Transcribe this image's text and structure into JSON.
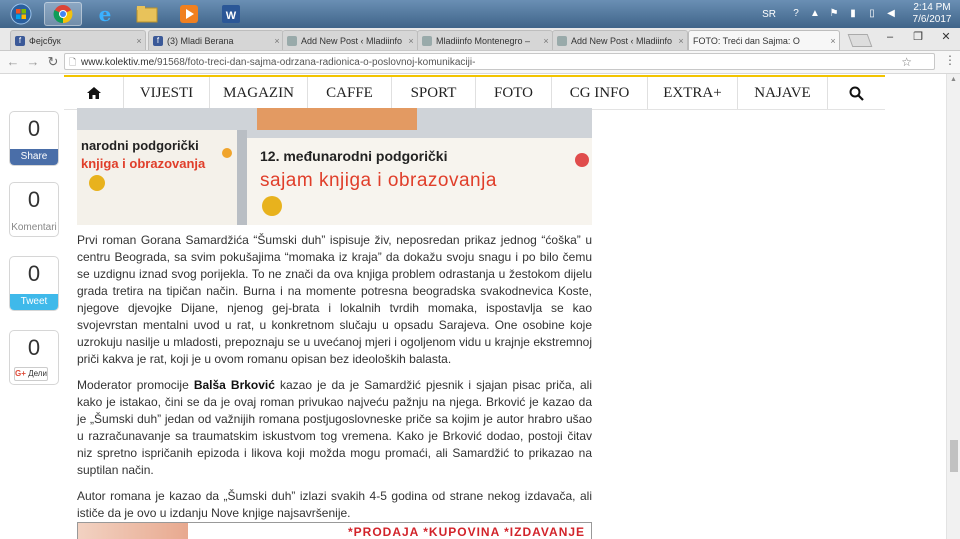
{
  "taskbar": {
    "language": "SR",
    "time": "2:14 PM",
    "date": "7/6/2017",
    "apps": [
      "start-orb-icon",
      "chrome-icon",
      "ie-icon",
      "file-explorer-icon",
      "media-player-icon",
      "word-icon"
    ]
  },
  "tabs": [
    {
      "title": "Фејсбук",
      "favicon": "f",
      "color": "#3b5998",
      "active": false
    },
    {
      "title": "(3) Mladi Berana",
      "favicon": "f",
      "color": "#3b5998",
      "active": false
    },
    {
      "title": "Add New Post ‹ Mladiinfo",
      "favicon": "",
      "color": "#9aa",
      "active": false
    },
    {
      "title": "Mladiinfo Montenegro –",
      "favicon": "",
      "color": "#9aa",
      "active": false
    },
    {
      "title": "Add New Post ‹ Mladiinfo",
      "favicon": "",
      "color": "#9aa",
      "active": false
    },
    {
      "title": "FOTO: Treći dan Sajma: O",
      "favicon": "",
      "color": "#9aa",
      "active": true
    }
  ],
  "omnibox": {
    "host": "www.kolektiv.me",
    "path": "/91568/foto-treci-dan-sajma-odrzana-radionica-o-poslovnoj-komunikaciji-"
  },
  "nav": {
    "items": [
      "VIJESTI",
      "MAGAZIN",
      "CAFFE",
      "SPORT",
      "FOTO",
      "CG INFO",
      "EXTRA+",
      "NAJAVE"
    ]
  },
  "share": [
    {
      "count": "0",
      "label": "Share",
      "color": "#4a6ea8"
    },
    {
      "count": "0",
      "label": "Komentari",
      "color": ""
    },
    {
      "count": "0",
      "label": "Tweet",
      "color": "#3fb9ea"
    },
    {
      "count": "0",
      "label": "Дели",
      "color": ""
    }
  ],
  "hero": {
    "banner_left_line1": "narodni podgorički",
    "banner_left_line2": "knjiga i obrazovanja",
    "banner_right_line1": "12. međunarodni podgorički",
    "banner_right_line2": "sajam knjiga i obrazovanja"
  },
  "article": {
    "p1": "Prvi roman Gorana Samardžića “Šumski duh” ispisuje živ, neposredan prikaz jednog “ćoška” u centru Beograda, sa svim pokušajima “momaka iz kraja” da dokažu svoju snagu i po bilo čemu se uzdignu iznad svog porijekla. To ne znači da ova knjiga problem odrastanja u žestokom dijelu grada tretira na tipičan način. Burna i na momente potresna beogradska svakodnevica Koste, njegove djevojke Dijane, njenog gej-brata i lokalnih tvrdih momaka, ispostavlja se kao svojevrstan mentalni uvod u rat, u konkretnom slučaju u opsadu Sarajeva. One osobine koje uzrokuju nasilje u mladosti, prepoznaju se u uvećanoj mjeri i ogoljenom vidu u krajnje ekstremnoj priči kakva je rat, koji je u ovom romanu opisan bez ideoloških balasta.",
    "p2_prefix": "Moderator promocije ",
    "p2_name": "Balša Brković",
    "p2_rest": " kazao je da je Samardžić pjesnik i sjajan pisac priča, ali kako je istakao, čini se da je ovaj roman privukao najveću pažnju na njega. Brković je kazao da je „Šumski duh” jedan od važnijih romana postjugoslovneske priče sa kojim je autor hrabro ušao u razračunavanje sa traumatskim iskustvom tog vremena. Kako je Brković dodao, postoji čitav niz spretno ispričanih epizoda i likova koji možda mogu promaći, ali Samardžić to prikazao na suptilan način.",
    "p3": "Autor romana je kazao da „Šumski duh” izlazi svakih 4-5 godina od strane nekog izdavača, ali ističe da je ovo u izdanju Nove knjige najsavršenije."
  },
  "ad": {
    "text": "*PRODAJA *KUPOVINA *IZDAVANJE"
  }
}
